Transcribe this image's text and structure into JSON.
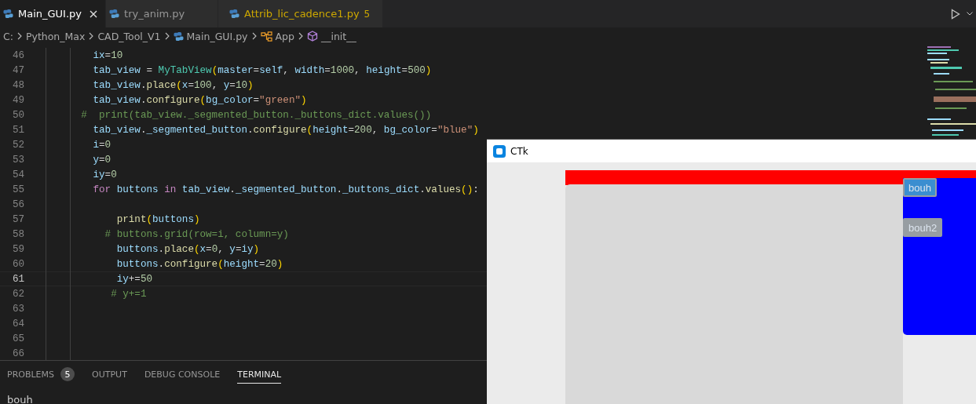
{
  "editor_tabs": [
    {
      "label": "Main_GUI.py",
      "selected": true,
      "warning": false
    },
    {
      "label": "try_anim.py",
      "selected": false,
      "warning": false
    },
    {
      "label": "Attrib_lic_cadence1.py",
      "selected": false,
      "warning": true,
      "problems": "5"
    }
  ],
  "breadcrumbs": [
    {
      "label": "C:",
      "kind": "folder"
    },
    {
      "label": "Python_Max",
      "kind": "folder"
    },
    {
      "label": "CAD_Tool_V1",
      "kind": "folder"
    },
    {
      "label": "Main_GUI.py",
      "kind": "python"
    },
    {
      "label": "App",
      "kind": "class"
    },
    {
      "label": "__init__",
      "kind": "method"
    }
  ],
  "code_lines": [
    {
      "number": "46",
      "current": false,
      "tokens": [
        {
          "text": "        ix",
          "kind": "var"
        },
        {
          "text": "=",
          "kind": "plain"
        },
        {
          "text": "10",
          "kind": "num"
        }
      ]
    },
    {
      "number": "47",
      "current": false,
      "tokens": [
        {
          "text": "        tab_view",
          "kind": "var"
        },
        {
          "text": " = ",
          "kind": "plain"
        },
        {
          "text": "MyTabView",
          "kind": "class"
        },
        {
          "text": "(",
          "kind": "paren"
        },
        {
          "text": "master",
          "kind": "var"
        },
        {
          "text": "=",
          "kind": "plain"
        },
        {
          "text": "self",
          "kind": "var"
        },
        {
          "text": ", ",
          "kind": "plain"
        },
        {
          "text": "width",
          "kind": "var"
        },
        {
          "text": "=",
          "kind": "plain"
        },
        {
          "text": "1000",
          "kind": "num"
        },
        {
          "text": ", ",
          "kind": "plain"
        },
        {
          "text": "height",
          "kind": "var"
        },
        {
          "text": "=",
          "kind": "plain"
        },
        {
          "text": "500",
          "kind": "num"
        },
        {
          "text": ")",
          "kind": "paren"
        }
      ]
    },
    {
      "number": "48",
      "current": false,
      "tokens": [
        {
          "text": "        tab_view",
          "kind": "var"
        },
        {
          "text": ".",
          "kind": "plain"
        },
        {
          "text": "place",
          "kind": "func"
        },
        {
          "text": "(",
          "kind": "paren"
        },
        {
          "text": "x",
          "kind": "var"
        },
        {
          "text": "=",
          "kind": "plain"
        },
        {
          "text": "100",
          "kind": "num"
        },
        {
          "text": ", ",
          "kind": "plain"
        },
        {
          "text": "y",
          "kind": "var"
        },
        {
          "text": "=",
          "kind": "plain"
        },
        {
          "text": "10",
          "kind": "num"
        },
        {
          "text": ")",
          "kind": "paren"
        }
      ]
    },
    {
      "number": "49",
      "current": false,
      "tokens": [
        {
          "text": "        tab_view",
          "kind": "var"
        },
        {
          "text": ".",
          "kind": "plain"
        },
        {
          "text": "configure",
          "kind": "func"
        },
        {
          "text": "(",
          "kind": "paren"
        },
        {
          "text": "bg_color",
          "kind": "var"
        },
        {
          "text": "=",
          "kind": "plain"
        },
        {
          "text": "\"green\"",
          "kind": "str"
        },
        {
          "text": ")",
          "kind": "paren"
        }
      ]
    },
    {
      "number": "50",
      "current": false,
      "tokens": [
        {
          "text": "      #  print(tab_view._segmented_button._buttons_dict.values())",
          "kind": "comment"
        }
      ]
    },
    {
      "number": "51",
      "current": false,
      "tokens": [
        {
          "text": "        tab_view",
          "kind": "var"
        },
        {
          "text": ".",
          "kind": "plain"
        },
        {
          "text": "_segmented_button",
          "kind": "var"
        },
        {
          "text": ".",
          "kind": "plain"
        },
        {
          "text": "configure",
          "kind": "func"
        },
        {
          "text": "(",
          "kind": "paren"
        },
        {
          "text": "height",
          "kind": "var"
        },
        {
          "text": "=",
          "kind": "plain"
        },
        {
          "text": "200",
          "kind": "num"
        },
        {
          "text": ", ",
          "kind": "plain"
        },
        {
          "text": "bg_color",
          "kind": "var"
        },
        {
          "text": "=",
          "kind": "plain"
        },
        {
          "text": "\"blue\"",
          "kind": "str"
        },
        {
          "text": ")",
          "kind": "paren"
        }
      ]
    },
    {
      "number": "52",
      "current": false,
      "tokens": [
        {
          "text": "        i",
          "kind": "var"
        },
        {
          "text": "=",
          "kind": "plain"
        },
        {
          "text": "0",
          "kind": "num"
        }
      ]
    },
    {
      "number": "53",
      "current": false,
      "tokens": [
        {
          "text": "        y",
          "kind": "var"
        },
        {
          "text": "=",
          "kind": "plain"
        },
        {
          "text": "0",
          "kind": "num"
        }
      ]
    },
    {
      "number": "54",
      "current": false,
      "tokens": [
        {
          "text": "        iy",
          "kind": "var"
        },
        {
          "text": "=",
          "kind": "plain"
        },
        {
          "text": "0",
          "kind": "num"
        }
      ]
    },
    {
      "number": "55",
      "current": false,
      "tokens": [
        {
          "text": "        for ",
          "kind": "keyword"
        },
        {
          "text": "buttons ",
          "kind": "var"
        },
        {
          "text": "in ",
          "kind": "keyword"
        },
        {
          "text": "tab_view",
          "kind": "var"
        },
        {
          "text": ".",
          "kind": "plain"
        },
        {
          "text": "_segmented_button",
          "kind": "var"
        },
        {
          "text": ".",
          "kind": "plain"
        },
        {
          "text": "_buttons_dict",
          "kind": "var"
        },
        {
          "text": ".",
          "kind": "plain"
        },
        {
          "text": "values",
          "kind": "func"
        },
        {
          "text": "()",
          "kind": "paren"
        },
        {
          "text": ":",
          "kind": "plain"
        }
      ]
    },
    {
      "number": "56",
      "current": false
    },
    {
      "number": "57",
      "current": false,
      "tokens": [
        {
          "text": "            print",
          "kind": "func"
        },
        {
          "text": "(",
          "kind": "paren"
        },
        {
          "text": "buttons",
          "kind": "var"
        },
        {
          "text": ")",
          "kind": "paren"
        }
      ]
    },
    {
      "number": "58",
      "current": false,
      "tokens": [
        {
          "text": "          # buttons.grid(row=i, column=y)",
          "kind": "comment"
        }
      ]
    },
    {
      "number": "59",
      "current": false,
      "tokens": [
        {
          "text": "            buttons",
          "kind": "var"
        },
        {
          "text": ".",
          "kind": "plain"
        },
        {
          "text": "place",
          "kind": "func"
        },
        {
          "text": "(",
          "kind": "paren"
        },
        {
          "text": "x",
          "kind": "var"
        },
        {
          "text": "=",
          "kind": "plain"
        },
        {
          "text": "0",
          "kind": "num"
        },
        {
          "text": ", ",
          "kind": "plain"
        },
        {
          "text": "y",
          "kind": "var"
        },
        {
          "text": "=",
          "kind": "plain"
        },
        {
          "text": "iy",
          "kind": "var"
        },
        {
          "text": ")",
          "kind": "paren"
        }
      ]
    },
    {
      "number": "60",
      "current": false,
      "tokens": [
        {
          "text": "            buttons",
          "kind": "var"
        },
        {
          "text": ".",
          "kind": "plain"
        },
        {
          "text": "configure",
          "kind": "func"
        },
        {
          "text": "(",
          "kind": "paren"
        },
        {
          "text": "height",
          "kind": "var"
        },
        {
          "text": "=",
          "kind": "plain"
        },
        {
          "text": "20",
          "kind": "num"
        },
        {
          "text": ")",
          "kind": "paren"
        }
      ]
    },
    {
      "number": "61",
      "current": true,
      "tokens": [
        {
          "text": "            iy",
          "kind": "var"
        },
        {
          "text": "+=",
          "kind": "plain"
        },
        {
          "text": "50",
          "kind": "num"
        }
      ]
    },
    {
      "number": "62",
      "current": false,
      "tokens": [
        {
          "text": "           # y+=1",
          "kind": "comment"
        }
      ]
    },
    {
      "number": "63",
      "current": false
    },
    {
      "number": "64",
      "current": false
    },
    {
      "number": "65",
      "current": false
    },
    {
      "number": "66",
      "current": false
    }
  ],
  "panel": {
    "tabs": [
      {
        "label": "PROBLEMS",
        "selected": false,
        "badge": "5"
      },
      {
        "label": "OUTPUT",
        "selected": false
      },
      {
        "label": "DEBUG CONSOLE",
        "selected": false
      },
      {
        "label": "TERMINAL",
        "selected": true
      }
    ],
    "terminal_output": [
      "bouh"
    ]
  },
  "ctk_window": {
    "title": "CTk",
    "buttons": [
      {
        "label": "bouh",
        "selected": true
      },
      {
        "label": "bouh2",
        "selected": false
      }
    ]
  }
}
